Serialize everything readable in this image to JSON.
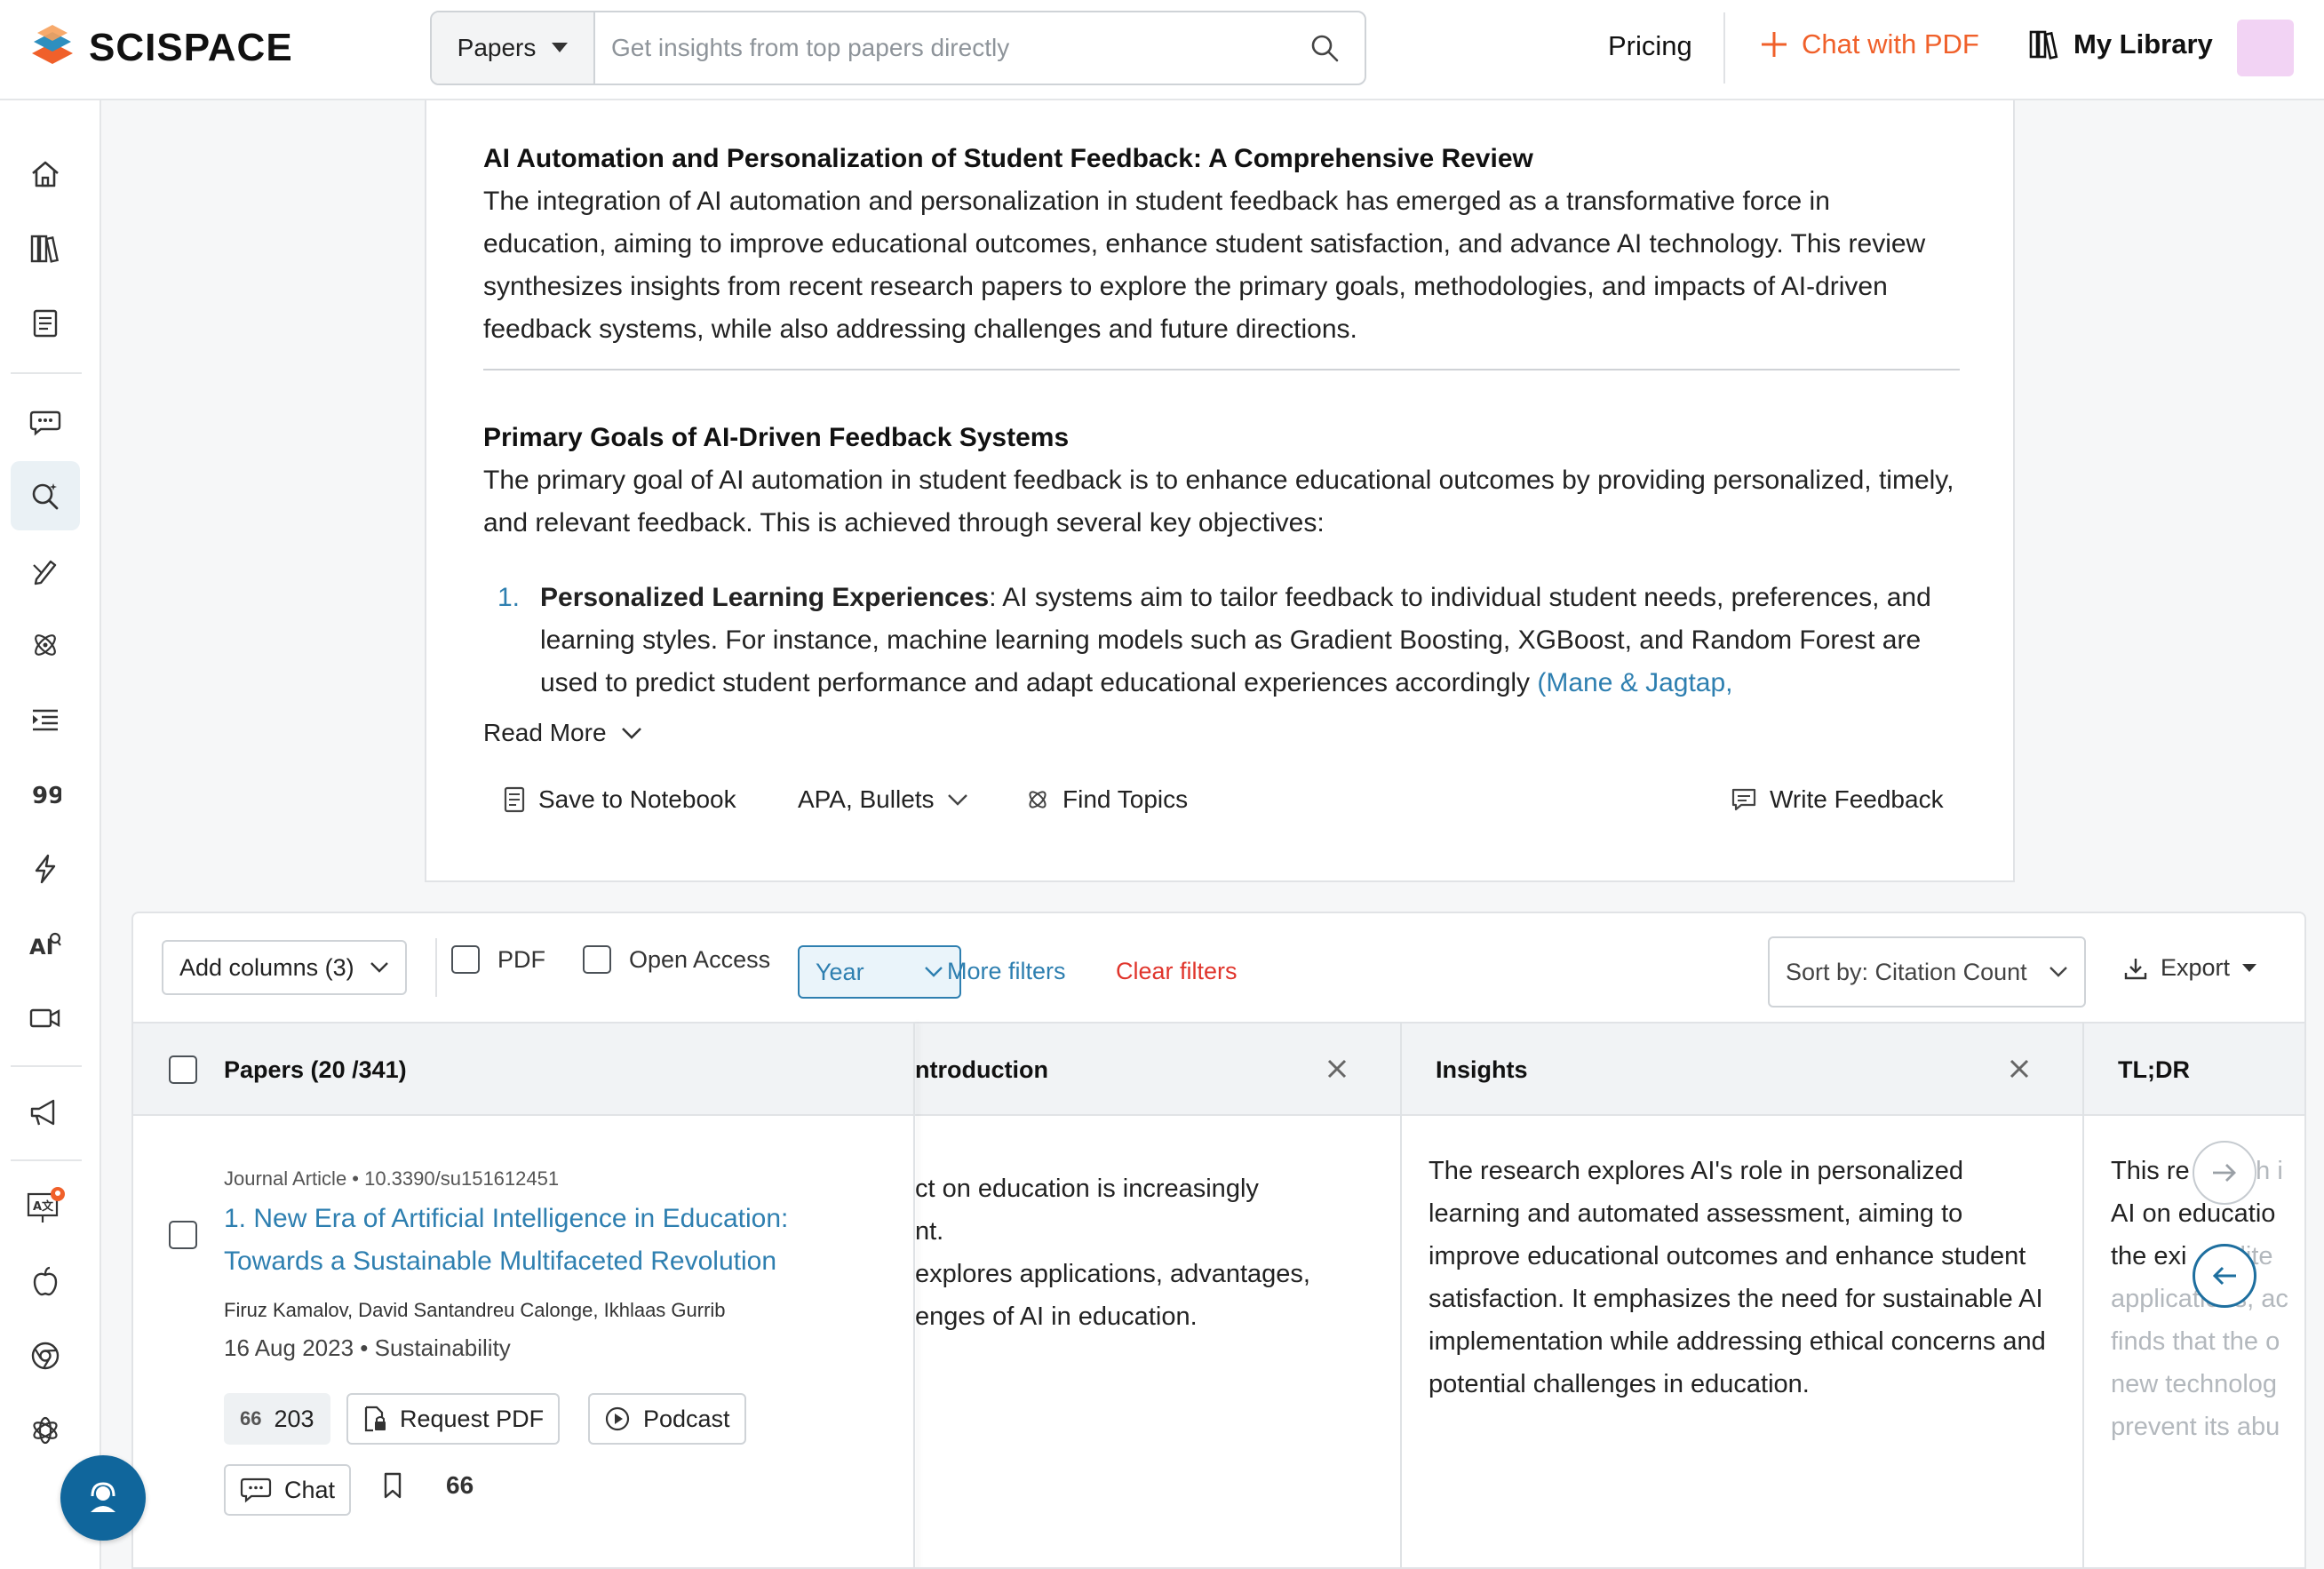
{
  "brand": {
    "name": "SCISPACE"
  },
  "search": {
    "scope": "Papers",
    "placeholder": "Get insights from top papers directly"
  },
  "nav": {
    "pricing": "Pricing",
    "chat_pdf": "Chat with PDF",
    "library": "My Library"
  },
  "summary": {
    "title": "AI Automation and Personalization of Student Feedback: A Comprehensive Review",
    "intro": "The integration of AI automation and personalization in student feedback has emerged as a transformative force in education, aiming to improve educational outcomes, enhance student satisfaction, and advance AI technology. This review synthesizes insights from recent research papers to explore the primary goals, methodologies, and impacts of AI-driven feedback systems, while also addressing challenges and future directions.",
    "section_title": "Primary Goals of AI-Driven Feedback Systems",
    "section_text": "The primary goal of AI automation in student feedback is to enhance educational outcomes by providing personalized, timely, and relevant feedback. This is achieved through several key objectives:",
    "list": [
      {
        "num": "1.",
        "bold": "Personalized Learning Experiences",
        "text": ": AI systems aim to tailor feedback to individual student needs, preferences, and learning styles. For instance, machine learning models such as Gradient Boosting, XGBoost, and Random Forest are used to predict student performance and adapt educational experiences accordingly ",
        "cite": "(Mane & Jagtap,"
      }
    ],
    "read_more": "Read More"
  },
  "actions": {
    "save": "Save to Notebook",
    "format": "APA, Bullets",
    "topics": "Find Topics",
    "feedback": "Write Feedback"
  },
  "filters": {
    "add_columns": "Add columns (3)",
    "pdf": "PDF",
    "open_access": "Open Access",
    "year": "Year",
    "more": "More filters",
    "clear": "Clear filters",
    "sort": "Sort by: Citation Count",
    "export": "Export"
  },
  "table": {
    "headers": {
      "papers": "Papers (20 /341)",
      "introduction": "ntroduction",
      "insights": "Insights",
      "tldr": "TL;DR"
    },
    "rows": [
      {
        "meta": "Journal Article • 10.3390/su151612451",
        "title": "1. New Era of Artificial Intelligence in Education: Towards a Sustainable Multifaceted Revolution",
        "authors": "Firuz Kamalov, David Santandreu Calonge, Ikhlaas Gurrib",
        "date": "16 Aug 2023",
        "venue": "Sustainability",
        "citations": "203",
        "request_pdf": "Request PDF",
        "podcast": "Podcast",
        "chat": "Chat",
        "quote_count": "66",
        "introduction": [
          "ct on education is increasingly",
          "nt.",
          " explores applications, advantages,",
          "enges of AI in education."
        ],
        "insights": "The research explores AI's role in personalized learning and automated assessment, aiming to improve educational outcomes and enhance student satisfaction. It emphasizes the need for sustainable AI implementation while addressing ethical concerns and potential challenges in education.",
        "tldr": [
          "This re",
          "ch i",
          "AI on educatio",
          "the exi",
          "lite",
          "applications, ac",
          "finds that the o",
          "new technolog",
          "prevent its abu"
        ]
      }
    ]
  },
  "colors": {
    "accent": "#2e7fb0",
    "brand_orange": "#f0602a",
    "danger": "#e0352c",
    "fab": "#10669c"
  }
}
